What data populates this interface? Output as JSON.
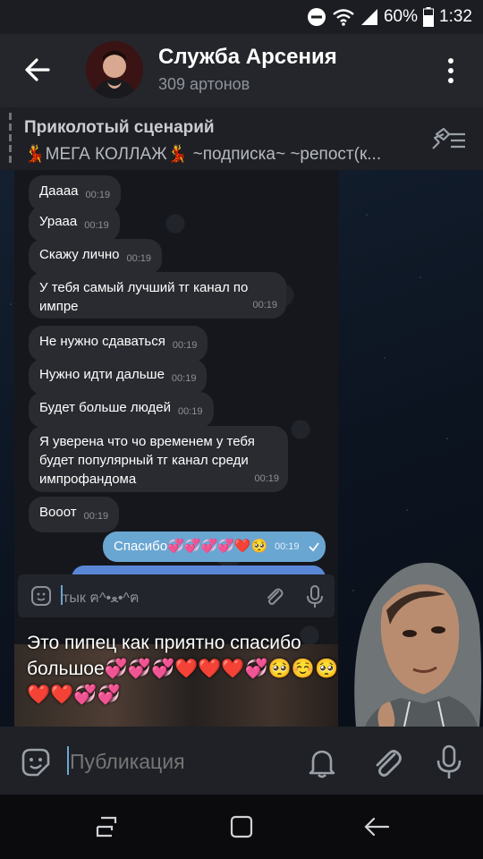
{
  "status_bar": {
    "battery": "60%",
    "time": "1:32",
    "icons": [
      "dnd-icon",
      "wifi-icon",
      "signal-icon",
      "battery-icon"
    ]
  },
  "header": {
    "title": "Служба Арсения",
    "subtitle": "309 артонов",
    "back_icon": "arrow-left-icon",
    "menu_icon": "more-vertical-icon"
  },
  "pinned": {
    "title": "Приколотый сценарий",
    "text": "💃МЕГА КОЛЛАЖ💃 ~подписка~ ~репост(к...",
    "icon": "unpin-icon"
  },
  "screenshot_chat": {
    "messages": [
      {
        "text": "Даааа",
        "time": "00:19"
      },
      {
        "text": "Урааа",
        "time": "00:19"
      },
      {
        "text": "Скажу лично",
        "time": "00:19"
      },
      {
        "text": "У тебя самый лучший тг канал по импре",
        "time": "00:19"
      },
      {
        "text": "Не нужно сдаваться",
        "time": "00:19"
      },
      {
        "text": "Нужно идти дальше",
        "time": "00:19"
      },
      {
        "text": "Будет больше людей",
        "time": "00:19"
      },
      {
        "text": "Я уверена что чо временем у тебя будет популярный тг канал среди импрофандома",
        "time": "00:19"
      },
      {
        "text": "Вооот",
        "time": "00:19"
      }
    ],
    "outgoing": {
      "text": "Спасибо💞💞💞💞❤️🥺",
      "time": "00:19"
    },
    "composer_placeholder": "тык ฅ^•ﻌ•^ฅ"
  },
  "caption": "Это пипец как приятно спасибо большое💞💞💞❤️❤️❤️💞🥺☺️🥺❤️❤️💞💞",
  "input": {
    "placeholder": "Публикация"
  },
  "colors": {
    "header_bg": "#24262b",
    "accent": "#6aa6d2",
    "outgoing_bubble": "#6aa6d2",
    "incoming_bubble": "#2a2b31"
  }
}
